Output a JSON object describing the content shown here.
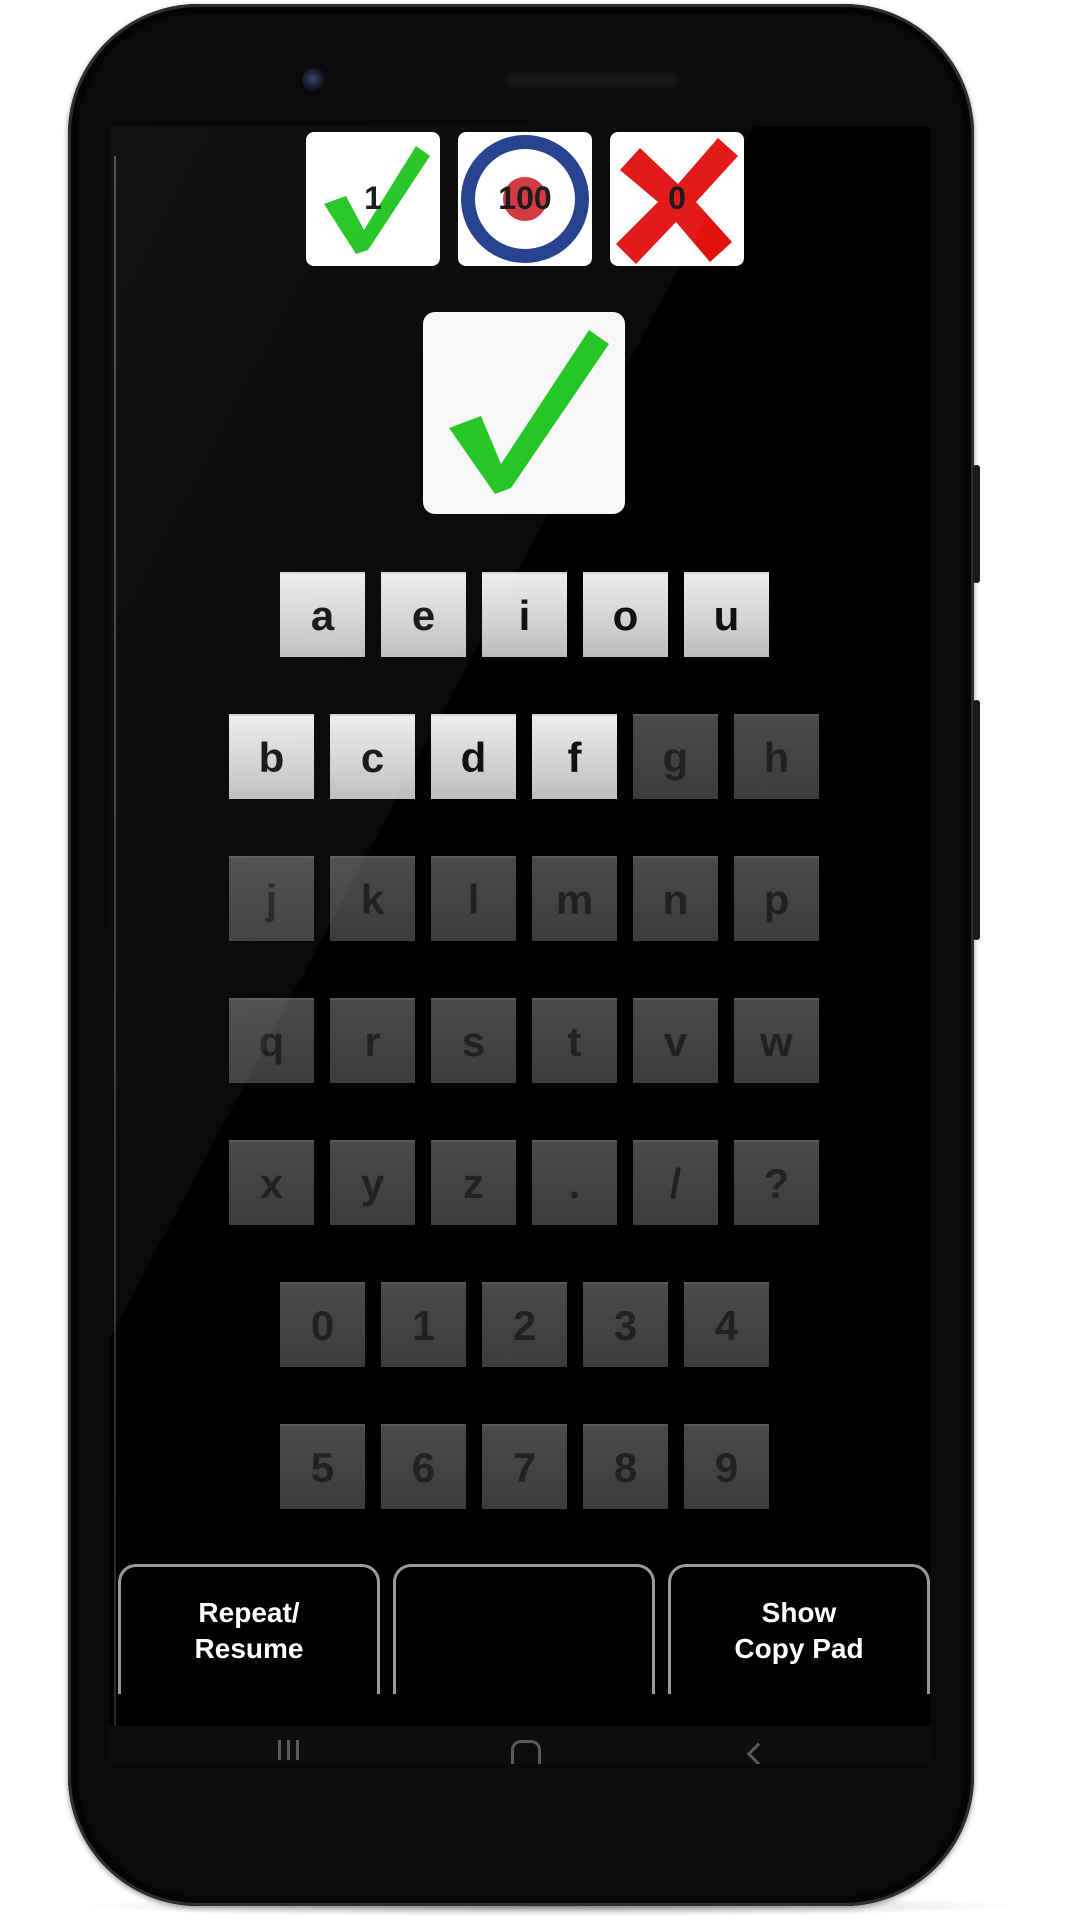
{
  "score": {
    "correct_count": "1",
    "target_count": "100",
    "wrong_count": "0"
  },
  "colors": {
    "check_green": "#1ec41e",
    "cross_red": "#e31010",
    "target_blue": "#1d3a8a",
    "target_red": "#d32f3b",
    "key_enabled": "#d6d6d6",
    "key_disabled": "#444444"
  },
  "result_icon": "check-mark-icon",
  "keyboard": {
    "vowels": [
      {
        "label": "a",
        "enabled": true
      },
      {
        "label": "e",
        "enabled": true
      },
      {
        "label": "i",
        "enabled": true
      },
      {
        "label": "o",
        "enabled": true
      },
      {
        "label": "u",
        "enabled": true
      }
    ],
    "row2": [
      {
        "label": "b",
        "enabled": true
      },
      {
        "label": "c",
        "enabled": true
      },
      {
        "label": "d",
        "enabled": true
      },
      {
        "label": "f",
        "enabled": true
      },
      {
        "label": "g",
        "enabled": false
      },
      {
        "label": "h",
        "enabled": false
      }
    ],
    "row3": [
      {
        "label": "j",
        "enabled": false
      },
      {
        "label": "k",
        "enabled": false
      },
      {
        "label": "l",
        "enabled": false
      },
      {
        "label": "m",
        "enabled": false
      },
      {
        "label": "n",
        "enabled": false
      },
      {
        "label": "p",
        "enabled": false
      }
    ],
    "row4": [
      {
        "label": "q",
        "enabled": false
      },
      {
        "label": "r",
        "enabled": false
      },
      {
        "label": "s",
        "enabled": false
      },
      {
        "label": "t",
        "enabled": false
      },
      {
        "label": "v",
        "enabled": false
      },
      {
        "label": "w",
        "enabled": false
      }
    ],
    "row5": [
      {
        "label": "x",
        "enabled": false
      },
      {
        "label": "y",
        "enabled": false
      },
      {
        "label": "z",
        "enabled": false
      },
      {
        "label": ".",
        "enabled": false
      },
      {
        "label": "/",
        "enabled": false
      },
      {
        "label": "?",
        "enabled": false
      }
    ],
    "digits1": [
      {
        "label": "0",
        "enabled": false
      },
      {
        "label": "1",
        "enabled": false
      },
      {
        "label": "2",
        "enabled": false
      },
      {
        "label": "3",
        "enabled": false
      },
      {
        "label": "4",
        "enabled": false
      }
    ],
    "digits2": [
      {
        "label": "5",
        "enabled": false
      },
      {
        "label": "6",
        "enabled": false
      },
      {
        "label": "7",
        "enabled": false
      },
      {
        "label": "8",
        "enabled": false
      },
      {
        "label": "9",
        "enabled": false
      }
    ]
  },
  "buttons": {
    "repeat_label": "Repeat/\nResume",
    "middle_label": "",
    "copy_label": "Show\nCopy Pad"
  },
  "navbar": {
    "recent_icon": "recent-apps-icon",
    "home_icon": "home-icon",
    "back_icon": "back-icon"
  }
}
